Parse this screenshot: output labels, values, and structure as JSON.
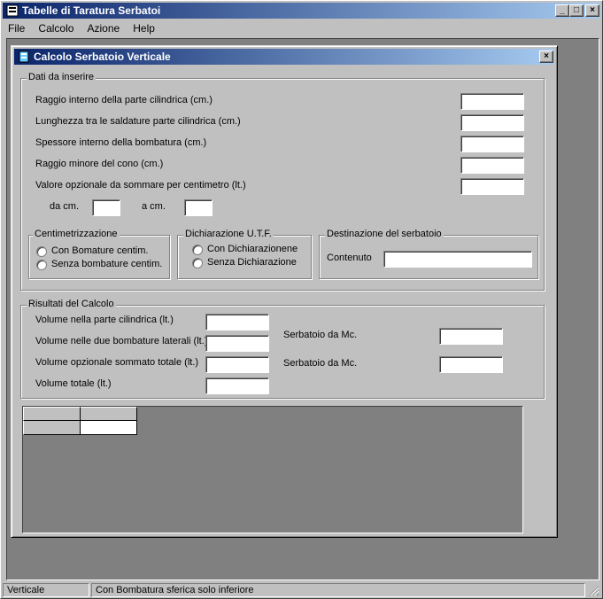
{
  "main": {
    "title": "Tabelle di Taratura Serbatoi",
    "menu": [
      "File",
      "Calcolo",
      "Azione",
      "Help"
    ],
    "window_buttons": {
      "minimize": "_",
      "maximize": "□",
      "close": "×"
    }
  },
  "dialog": {
    "title": "Calcolo Serbatoio Verticale",
    "close": "×",
    "inputs_group": {
      "label": "Dati da inserire",
      "fields": [
        {
          "label": "Raggio interno della parte cilindrica (cm.)",
          "value": ""
        },
        {
          "label": "Lunghezza tra le saldature parte cilindrica (cm.)",
          "value": ""
        },
        {
          "label": "Spessore interno della bombatura (cm.)",
          "value": ""
        },
        {
          "label": "Raggio minore del cono (cm.)",
          "value": ""
        },
        {
          "label": "Valore opzionale da sommare per centimetro (lt.)",
          "value": ""
        }
      ],
      "from_label": "da cm.",
      "from_value": "",
      "to_label": "a cm.",
      "to_value": ""
    },
    "centim_group": {
      "label": "Centimetrizzazione",
      "options": [
        "Con Bomature centim.",
        "Senza bombature centim."
      ]
    },
    "utf_group": {
      "label": "Dichiarazione U.T.F.",
      "options": [
        "Con Dichiarazionene",
        "Senza Dichiarazione"
      ]
    },
    "dest_group": {
      "label": "Destinazione del serbatoio",
      "content_label": "Contenuto",
      "content_value": ""
    },
    "results_group": {
      "label": "Risultati del Calcolo",
      "fields": [
        {
          "label": "Volume nella parte cilindrica (lt.)",
          "value": ""
        },
        {
          "label": "Volume nelle due bombature laterali (lt.)",
          "value": ""
        },
        {
          "label": "Volume opzionale sommato totale (lt.)",
          "value": ""
        },
        {
          "label": "Volume totale (lt.)",
          "value": ""
        }
      ],
      "side_fields": [
        {
          "label": "Serbatoio da Mc.",
          "value": ""
        },
        {
          "label": "Serbatoio da Mc.",
          "value": ""
        }
      ]
    }
  },
  "status": {
    "left": "Verticale",
    "right": "Con Bombatura sferica solo inferiore"
  }
}
